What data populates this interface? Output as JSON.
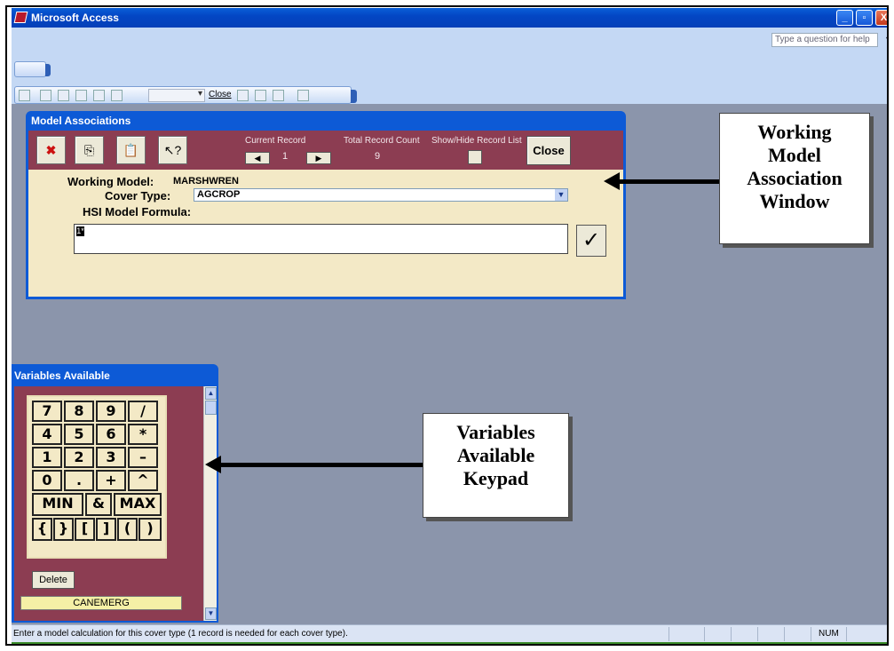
{
  "window": {
    "title": "Microsoft Access",
    "help_placeholder": "Type a question for help",
    "min_label": "_",
    "max_label": "▫",
    "close_label": "X"
  },
  "toolbar": {
    "close_label": "Close"
  },
  "model_window": {
    "title": "Model Associations",
    "current_record_label": "Current Record",
    "current_record_value": "1",
    "total_count_label": "Total Record Count",
    "total_count_value": "9",
    "show_hide_label": "Show/Hide Record List",
    "close_label": "Close",
    "working_model_label": "Working Model:",
    "working_model_value": "MARSHWREN",
    "cover_type_label": "Cover Type:",
    "cover_type_value": "AGCROP",
    "hsi_label": "HSI Model Formula:",
    "formula_value": "1*",
    "check_glyph": "✓",
    "prev_glyph": "◀",
    "next_glyph": "▶",
    "delete_glyph": "✖",
    "copy_glyph": "⎘",
    "paste_glyph": "📋",
    "help_glyph": "↖?"
  },
  "variables_window": {
    "title": "Variables Available",
    "keys": [
      [
        "7",
        "8",
        "9",
        "/"
      ],
      [
        "4",
        "5",
        "6",
        "*"
      ],
      [
        "1",
        "2",
        "3",
        "–"
      ],
      [
        "0",
        ".",
        "+",
        "^"
      ]
    ],
    "row5": [
      "MIN",
      "&",
      "MAX"
    ],
    "row6": [
      "{",
      "}",
      "[",
      "]",
      "(",
      ")"
    ],
    "delete_label": "Delete",
    "variable_value": "CANEMERG"
  },
  "status": {
    "text": "Enter a model calculation for this cover type (1 record is needed for each cover type).",
    "num": "NUM"
  },
  "annotations": {
    "working": "Working\nModel\nAssociation\nWindow",
    "variables": "Variables\nAvailable\nKeypad"
  }
}
